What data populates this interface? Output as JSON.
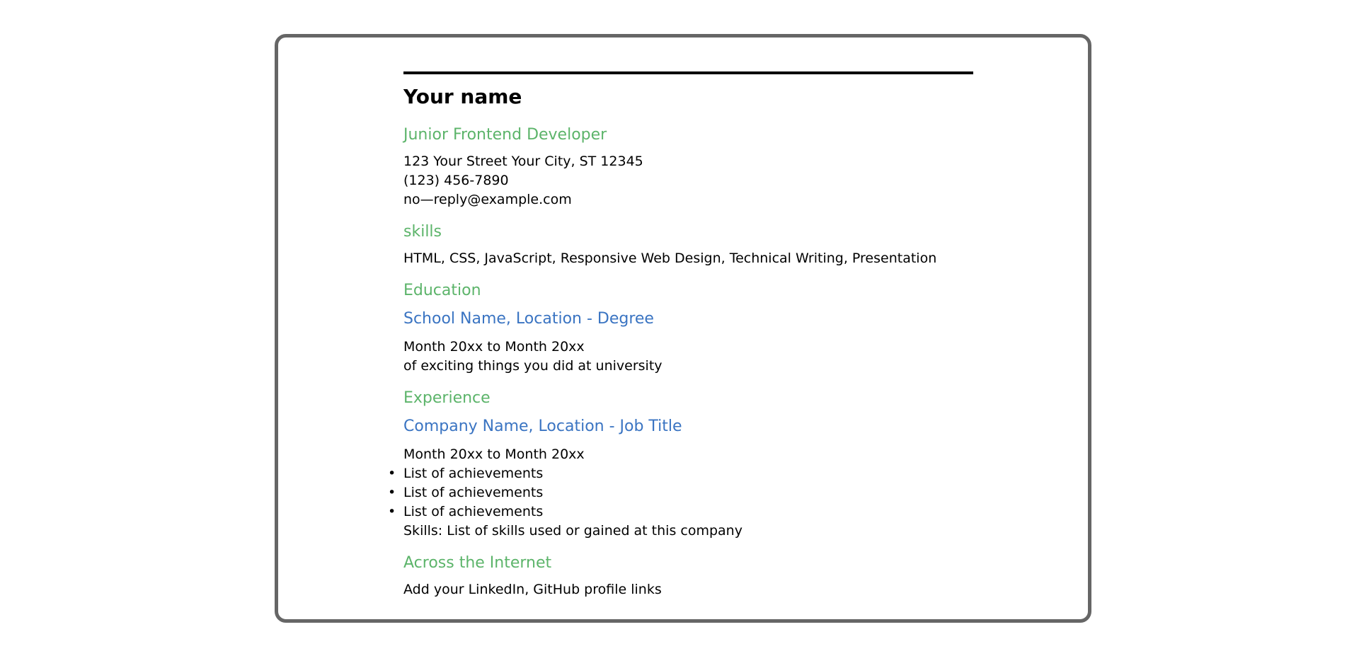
{
  "resume": {
    "name": "Your name",
    "job_title": "Junior Frontend Developer",
    "contact": {
      "address": "123 Your Street Your City, ST 12345",
      "phone": "(123) 456-7890",
      "email": "no—reply@example.com"
    },
    "skills": {
      "heading": "skills",
      "text": "HTML, CSS, JavaScript, Responsive Web Design, Technical Writing, Presentation"
    },
    "education": {
      "heading": "Education",
      "entry_title": "School Name, Location - Degree",
      "dates": "Month 20xx to Month 20xx",
      "description": "of exciting things you did at university"
    },
    "experience": {
      "heading": "Experience",
      "entry_title": "Company Name, Location - Job Title",
      "dates": "Month 20xx to Month 20xx",
      "achievements": [
        "List of achievements",
        "List of achievements",
        "List of achievements"
      ],
      "skills_used": "Skills: List of skills used or gained at this company"
    },
    "internet": {
      "heading": "Across the Internet",
      "text": "Add your LinkedIn, GitHub profile links"
    }
  },
  "colors": {
    "section_heading": "#5cb46a",
    "entry_title": "#3a74c2",
    "frame_border": "#666666",
    "rule": "#000000"
  },
  "icons": {
    "list_bullet": "•"
  }
}
